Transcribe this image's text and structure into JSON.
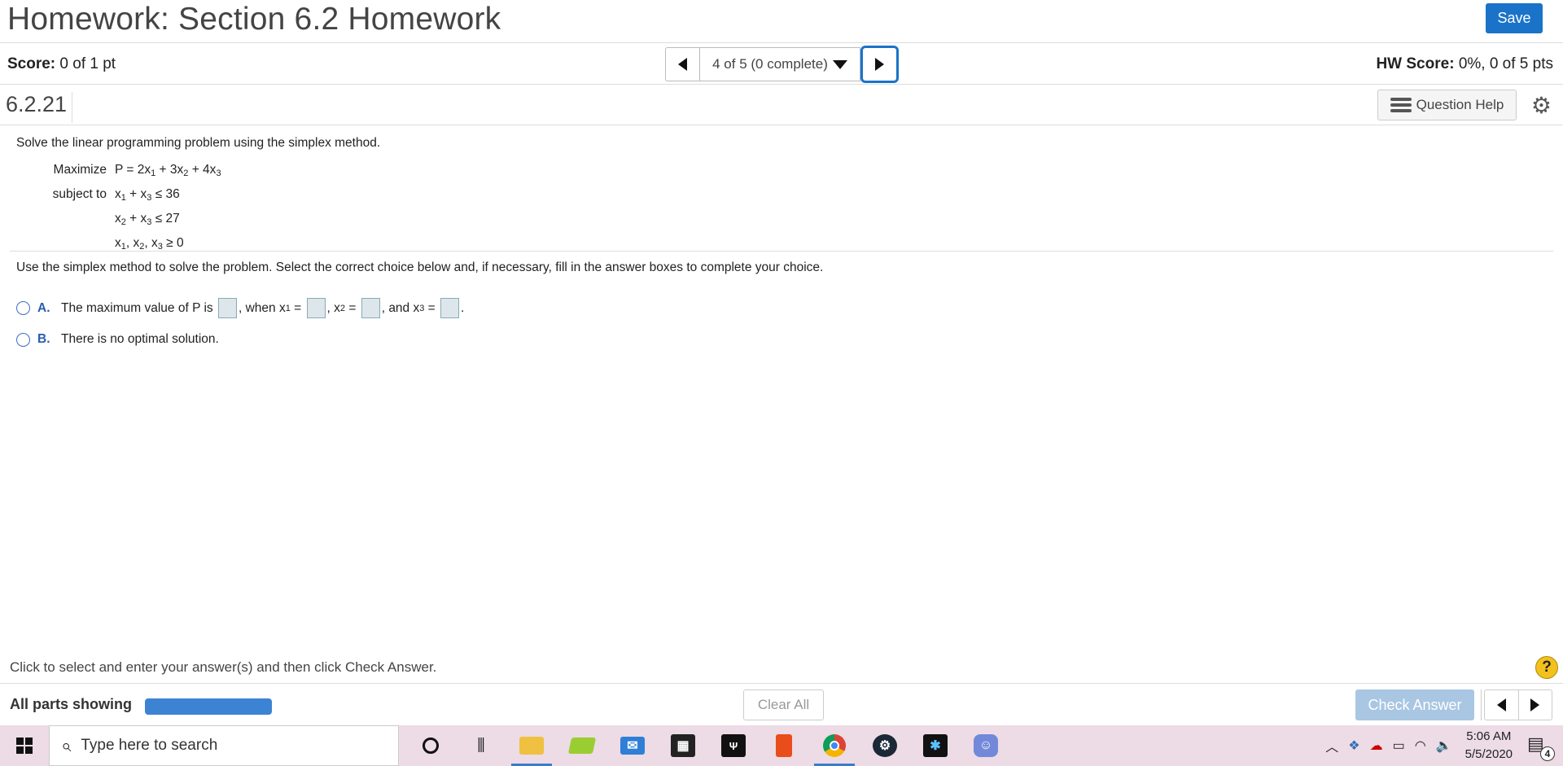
{
  "header": {
    "title": "Homework: Section 6.2 Homework",
    "save_label": "Save"
  },
  "scorebar": {
    "score_label": "Score:",
    "score_value": "0 of 1 pt",
    "nav_selected": "4 of 5 (0 complete)",
    "hw_label": "HW Score:",
    "hw_value": "0%, 0 of 5 pts"
  },
  "question": {
    "id": "6.2.21",
    "help_label": "Question Help",
    "prompt": "Solve the linear programming problem using the simplex method.",
    "problem": {
      "maximize_label": "Maximize",
      "subject_label": "subject to"
    },
    "instructions": "Use the simplex method to solve the problem. Select the correct choice below and, if necessary, fill in the answer boxes to complete your choice.",
    "choices": [
      {
        "letter": "A.",
        "text_1": "The maximum value of P is",
        "text_2": ", when x",
        "text_3": "=",
        "text_4": ", x",
        "text_5": "=",
        "text_6": ", and x",
        "text_7": "=",
        "text_8": "."
      },
      {
        "letter": "B.",
        "text": "There is no optimal solution."
      }
    ]
  },
  "footer": {
    "hint": "Click to select and enter your answer(s) and then click Check Answer.",
    "all_parts": "All parts showing",
    "progress_fraction": 1.0,
    "clear_label": "Clear All",
    "check_label": "Check Answer",
    "help_symbol": "?"
  },
  "taskbar": {
    "search_placeholder": "Type here to search",
    "time": "5:06 AM",
    "date": "5/5/2020",
    "notification_count": "4"
  }
}
